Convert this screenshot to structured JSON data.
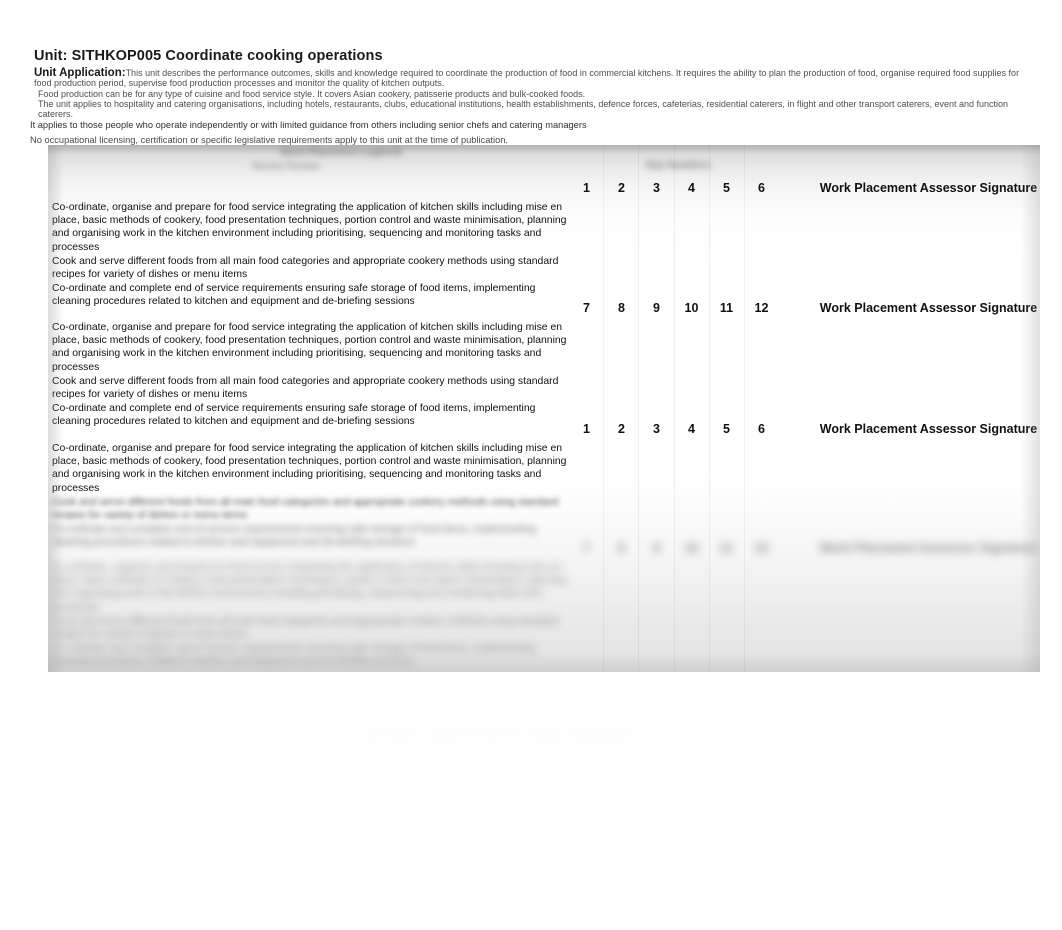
{
  "document": {
    "unit_title": "Unit: SITHKOP005 Coordinate cooking operations",
    "unit_application_label": "Unit Application:",
    "unit_application_paragraphs": [
      "This unit describes the performance outcomes, skills and knowledge required to coordinate the production of food in commercial kitchens. It requires the ability to plan the production of food, organise required food supplies for food production period, supervise food production processes and monitor the quality of kitchen outputs.",
      "Food production can be for any type of cuisine and food service style. It covers Asian cookery, patisserie products and bulk-cooked foods.",
      "The unit applies to hospitality and catering organisations, including hotels, restaurants, clubs, educational institutions, health establishments, defence forces, cafeterias, residential caterers, in flight and other transport caterers, event and function caterers."
    ],
    "applies_to_line": "It applies to those people who operate independently or with limited guidance from others including senior chefs and catering managers",
    "licensing_line": "No occupational licensing, certification or specific legislative requirements apply to this unit at the time of publication."
  },
  "logbook": {
    "banner": {
      "title": "Work Placement Logbook",
      "subtitle": "Service Periods",
      "days_label": "Day Numbers"
    },
    "signature_column_header": "Work Placement Assessor Signature",
    "tasks": {
      "task_1": "Co-ordinate, organise and prepare for food service integrating the application of kitchen skills including mise en place, basic methods of cookery, food presentation techniques, portion control and waste minimisation, planning and organising work in the kitchen environment including prioritising, sequencing and monitoring tasks and processes",
      "task_2": "Cook and serve different foods from all main food categories and appropriate cookery methods using standard recipes for variety of dishes or menu items",
      "task_3": "Co-ordinate and complete end of service requirements ensuring safe storage of food items, implementing cleaning procedures related to kitchen and equipment and de-briefing sessions"
    },
    "blocks": [
      {
        "id": "block-1",
        "days": [
          "1",
          "2",
          "3",
          "4",
          "5",
          "6"
        ],
        "signature_header": "Work Placement Assessor Signature"
      },
      {
        "id": "block-2",
        "days": [
          "7",
          "8",
          "9",
          "10",
          "11",
          "12"
        ],
        "signature_header": "Work Placement Assessor Signature"
      },
      {
        "id": "block-3",
        "days": [
          "1",
          "2",
          "3",
          "4",
          "5",
          "6"
        ],
        "signature_header": "Work Placement Assessor Signature"
      },
      {
        "id": "block-4",
        "days": [
          "7",
          "8",
          "9",
          "10",
          "11",
          "12"
        ],
        "signature_header": "Work Placement Assessor Signature"
      }
    ]
  },
  "footer": {
    "note": "Work Placement Logbook  |  SITHKOP005 Coordinate cooking operations"
  }
}
